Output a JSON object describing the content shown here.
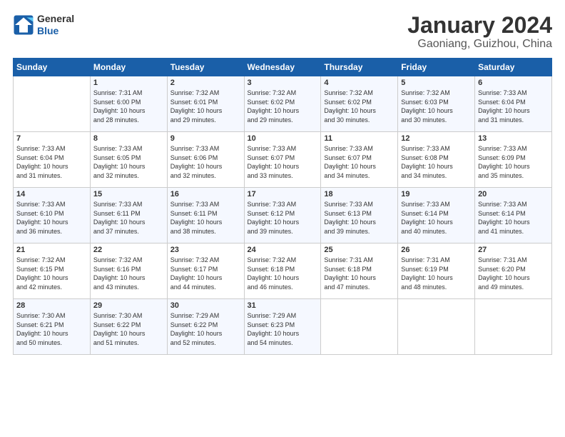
{
  "logo": {
    "text_general": "General",
    "text_blue": "Blue"
  },
  "header": {
    "title": "January 2024",
    "subtitle": "Gaoniang, Guizhou, China"
  },
  "days_of_week": [
    "Sunday",
    "Monday",
    "Tuesday",
    "Wednesday",
    "Thursday",
    "Friday",
    "Saturday"
  ],
  "weeks": [
    [
      {
        "day": "",
        "info": ""
      },
      {
        "day": "1",
        "info": "Sunrise: 7:31 AM\nSunset: 6:00 PM\nDaylight: 10 hours\nand 28 minutes."
      },
      {
        "day": "2",
        "info": "Sunrise: 7:32 AM\nSunset: 6:01 PM\nDaylight: 10 hours\nand 29 minutes."
      },
      {
        "day": "3",
        "info": "Sunrise: 7:32 AM\nSunset: 6:02 PM\nDaylight: 10 hours\nand 29 minutes."
      },
      {
        "day": "4",
        "info": "Sunrise: 7:32 AM\nSunset: 6:02 PM\nDaylight: 10 hours\nand 30 minutes."
      },
      {
        "day": "5",
        "info": "Sunrise: 7:32 AM\nSunset: 6:03 PM\nDaylight: 10 hours\nand 30 minutes."
      },
      {
        "day": "6",
        "info": "Sunrise: 7:33 AM\nSunset: 6:04 PM\nDaylight: 10 hours\nand 31 minutes."
      }
    ],
    [
      {
        "day": "7",
        "info": "Sunrise: 7:33 AM\nSunset: 6:04 PM\nDaylight: 10 hours\nand 31 minutes."
      },
      {
        "day": "8",
        "info": "Sunrise: 7:33 AM\nSunset: 6:05 PM\nDaylight: 10 hours\nand 32 minutes."
      },
      {
        "day": "9",
        "info": "Sunrise: 7:33 AM\nSunset: 6:06 PM\nDaylight: 10 hours\nand 32 minutes."
      },
      {
        "day": "10",
        "info": "Sunrise: 7:33 AM\nSunset: 6:07 PM\nDaylight: 10 hours\nand 33 minutes."
      },
      {
        "day": "11",
        "info": "Sunrise: 7:33 AM\nSunset: 6:07 PM\nDaylight: 10 hours\nand 34 minutes."
      },
      {
        "day": "12",
        "info": "Sunrise: 7:33 AM\nSunset: 6:08 PM\nDaylight: 10 hours\nand 34 minutes."
      },
      {
        "day": "13",
        "info": "Sunrise: 7:33 AM\nSunset: 6:09 PM\nDaylight: 10 hours\nand 35 minutes."
      }
    ],
    [
      {
        "day": "14",
        "info": "Sunrise: 7:33 AM\nSunset: 6:10 PM\nDaylight: 10 hours\nand 36 minutes."
      },
      {
        "day": "15",
        "info": "Sunrise: 7:33 AM\nSunset: 6:11 PM\nDaylight: 10 hours\nand 37 minutes."
      },
      {
        "day": "16",
        "info": "Sunrise: 7:33 AM\nSunset: 6:11 PM\nDaylight: 10 hours\nand 38 minutes."
      },
      {
        "day": "17",
        "info": "Sunrise: 7:33 AM\nSunset: 6:12 PM\nDaylight: 10 hours\nand 39 minutes."
      },
      {
        "day": "18",
        "info": "Sunrise: 7:33 AM\nSunset: 6:13 PM\nDaylight: 10 hours\nand 39 minutes."
      },
      {
        "day": "19",
        "info": "Sunrise: 7:33 AM\nSunset: 6:14 PM\nDaylight: 10 hours\nand 40 minutes."
      },
      {
        "day": "20",
        "info": "Sunrise: 7:33 AM\nSunset: 6:14 PM\nDaylight: 10 hours\nand 41 minutes."
      }
    ],
    [
      {
        "day": "21",
        "info": "Sunrise: 7:32 AM\nSunset: 6:15 PM\nDaylight: 10 hours\nand 42 minutes."
      },
      {
        "day": "22",
        "info": "Sunrise: 7:32 AM\nSunset: 6:16 PM\nDaylight: 10 hours\nand 43 minutes."
      },
      {
        "day": "23",
        "info": "Sunrise: 7:32 AM\nSunset: 6:17 PM\nDaylight: 10 hours\nand 44 minutes."
      },
      {
        "day": "24",
        "info": "Sunrise: 7:32 AM\nSunset: 6:18 PM\nDaylight: 10 hours\nand 46 minutes."
      },
      {
        "day": "25",
        "info": "Sunrise: 7:31 AM\nSunset: 6:18 PM\nDaylight: 10 hours\nand 47 minutes."
      },
      {
        "day": "26",
        "info": "Sunrise: 7:31 AM\nSunset: 6:19 PM\nDaylight: 10 hours\nand 48 minutes."
      },
      {
        "day": "27",
        "info": "Sunrise: 7:31 AM\nSunset: 6:20 PM\nDaylight: 10 hours\nand 49 minutes."
      }
    ],
    [
      {
        "day": "28",
        "info": "Sunrise: 7:30 AM\nSunset: 6:21 PM\nDaylight: 10 hours\nand 50 minutes."
      },
      {
        "day": "29",
        "info": "Sunrise: 7:30 AM\nSunset: 6:22 PM\nDaylight: 10 hours\nand 51 minutes."
      },
      {
        "day": "30",
        "info": "Sunrise: 7:29 AM\nSunset: 6:22 PM\nDaylight: 10 hours\nand 52 minutes."
      },
      {
        "day": "31",
        "info": "Sunrise: 7:29 AM\nSunset: 6:23 PM\nDaylight: 10 hours\nand 54 minutes."
      },
      {
        "day": "",
        "info": ""
      },
      {
        "day": "",
        "info": ""
      },
      {
        "day": "",
        "info": ""
      }
    ]
  ]
}
